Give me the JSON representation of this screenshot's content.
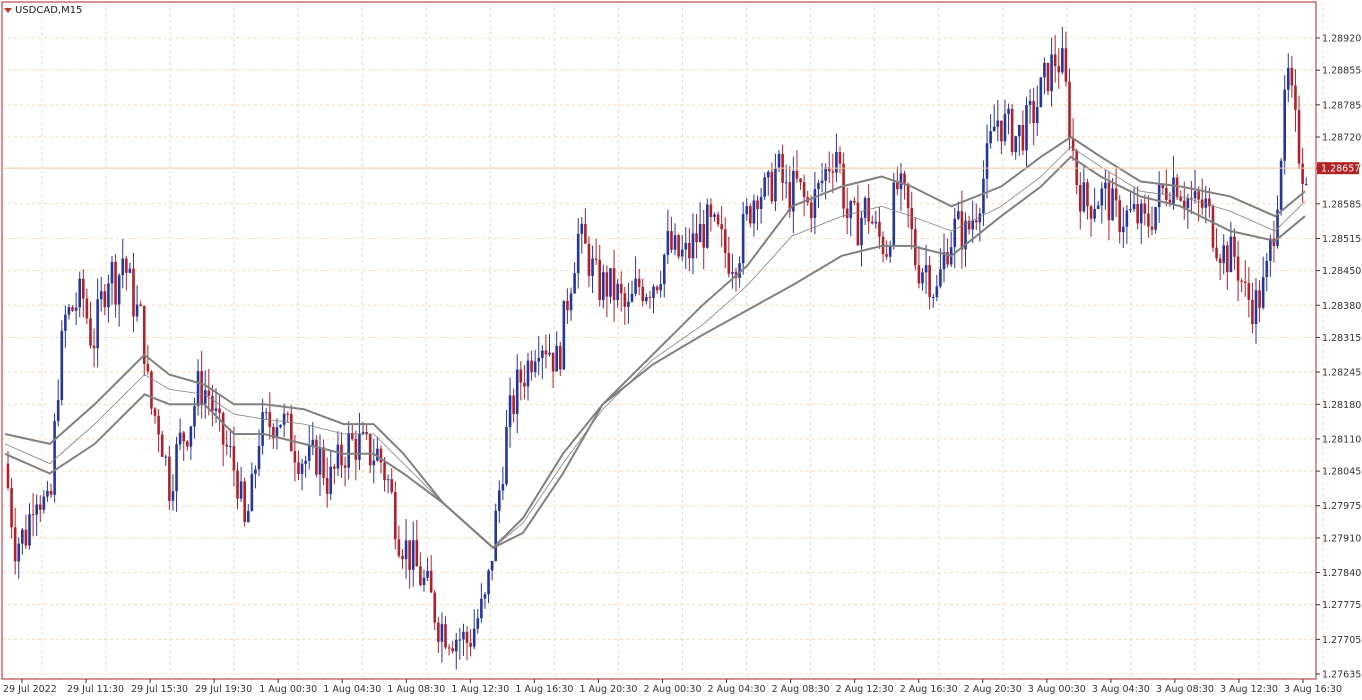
{
  "window": {
    "symbol_title": "USDCAD,M15"
  },
  "colors": {
    "background": "#ffffff",
    "frame": "#b22222",
    "grid": "#f3dcbf",
    "bull_candle": "#2336a0",
    "bear_candle": "#b0202a",
    "ma_line": "#808080",
    "current_price_bg": "#b22222",
    "current_price_text": "#ffffff",
    "axis_text": "#333333"
  },
  "chart_data": {
    "type": "candlestick",
    "symbol": "USDCAD",
    "timeframe": "M15",
    "price_axis_ticks": [
      "1.28920",
      "1.28855",
      "1.28785",
      "1.28720",
      "1.28657",
      "1.28585",
      "1.28515",
      "1.28450",
      "1.28380",
      "1.28315",
      "1.28245",
      "1.28180",
      "1.28110",
      "1.28045",
      "1.27975",
      "1.27910",
      "1.27840",
      "1.27775",
      "1.27705",
      "1.27635"
    ],
    "current_price": "1.28657",
    "ylim": [
      1.27635,
      1.28955
    ],
    "time_axis_labels": [
      "29 Jul 2022",
      "29 Jul 11:30",
      "29 Jul 15:30",
      "29 Jul 19:30",
      "1 Aug 00:30",
      "1 Aug 04:30",
      "1 Aug 08:30",
      "1 Aug 12:30",
      "1 Aug 16:30",
      "1 Aug 20:30",
      "2 Aug 00:30",
      "2 Aug 04:30",
      "2 Aug 08:30",
      "2 Aug 12:30",
      "2 Aug 16:30",
      "2 Aug 20:30",
      "3 Aug 00:30",
      "3 Aug 04:30",
      "3 Aug 08:30",
      "3 Aug 12:30",
      "3 Aug 16:30"
    ],
    "close_path": [
      [
        0,
        1.2806
      ],
      [
        10,
        1.279
      ],
      [
        22,
        1.2792
      ],
      [
        30,
        1.2802
      ],
      [
        45,
        1.2795
      ],
      [
        52,
        1.282
      ],
      [
        60,
        1.2835
      ],
      [
        70,
        1.2838
      ],
      [
        78,
        1.284
      ],
      [
        88,
        1.283
      ],
      [
        98,
        1.284
      ],
      [
        105,
        1.2846
      ],
      [
        112,
        1.2842
      ],
      [
        118,
        1.2848
      ],
      [
        130,
        1.2838
      ],
      [
        138,
        1.2834
      ],
      [
        145,
        1.2818
      ],
      [
        155,
        1.2814
      ],
      [
        165,
        1.2802
      ],
      [
        175,
        1.281
      ],
      [
        185,
        1.2814
      ],
      [
        195,
        1.2822
      ],
      [
        205,
        1.282
      ],
      [
        215,
        1.2812
      ],
      [
        225,
        1.2808
      ],
      [
        235,
        1.2802
      ],
      [
        240,
        1.2792
      ],
      [
        248,
        1.28
      ],
      [
        255,
        1.2812
      ],
      [
        265,
        1.2814
      ],
      [
        275,
        1.2816
      ],
      [
        285,
        1.2812
      ],
      [
        295,
        1.2808
      ],
      [
        305,
        1.2806
      ],
      [
        315,
        1.2808
      ],
      [
        325,
        1.2802
      ],
      [
        335,
        1.2806
      ],
      [
        345,
        1.281
      ],
      [
        355,
        1.281
      ],
      [
        365,
        1.2808
      ],
      [
        375,
        1.2808
      ],
      [
        385,
        1.2802
      ],
      [
        395,
        1.2792
      ],
      [
        405,
        1.2788
      ],
      [
        415,
        1.2784
      ],
      [
        425,
        1.278
      ],
      [
        435,
        1.2774
      ],
      [
        445,
        1.2772
      ],
      [
        455,
        1.2771
      ],
      [
        465,
        1.277
      ],
      [
        475,
        1.2775
      ],
      [
        483,
        1.2778
      ],
      [
        490,
        1.279
      ],
      [
        497,
        1.2802
      ],
      [
        505,
        1.2814
      ],
      [
        515,
        1.2822
      ],
      [
        525,
        1.2826
      ],
      [
        535,
        1.2832
      ],
      [
        545,
        1.283
      ],
      [
        555,
        1.2826
      ],
      [
        565,
        1.284
      ],
      [
        575,
        1.2852
      ],
      [
        585,
        1.2848
      ],
      [
        595,
        1.2842
      ],
      [
        605,
        1.2842
      ],
      [
        615,
        1.284
      ],
      [
        625,
        1.2836
      ],
      [
        635,
        1.2842
      ],
      [
        645,
        1.2842
      ],
      [
        655,
        1.2844
      ],
      [
        665,
        1.285
      ],
      [
        675,
        1.2848
      ],
      [
        685,
        1.2848
      ],
      [
        695,
        1.2852
      ],
      [
        705,
        1.2854
      ],
      [
        715,
        1.2852
      ],
      [
        725,
        1.2848
      ],
      [
        735,
        1.2848
      ],
      [
        745,
        1.2856
      ],
      [
        755,
        1.2862
      ],
      [
        765,
        1.286
      ],
      [
        775,
        1.2866
      ],
      [
        785,
        1.286
      ],
      [
        795,
        1.2862
      ],
      [
        805,
        1.2858
      ],
      [
        815,
        1.286
      ],
      [
        825,
        1.2866
      ],
      [
        835,
        1.287
      ],
      [
        845,
        1.2856
      ],
      [
        855,
        1.2854
      ],
      [
        865,
        1.2858
      ],
      [
        875,
        1.2852
      ],
      [
        885,
        1.285
      ],
      [
        895,
        1.2862
      ],
      [
        905,
        1.2858
      ],
      [
        915,
        1.2846
      ],
      [
        925,
        1.2846
      ],
      [
        935,
        1.284
      ],
      [
        945,
        1.285
      ],
      [
        955,
        1.2854
      ],
      [
        965,
        1.2852
      ],
      [
        975,
        1.2858
      ],
      [
        985,
        1.2866
      ],
      [
        995,
        1.2876
      ],
      [
        1005,
        1.2874
      ],
      [
        1015,
        1.2872
      ],
      [
        1025,
        1.2874
      ],
      [
        1035,
        1.2878
      ],
      [
        1045,
        1.2884
      ],
      [
        1055,
        1.2888
      ],
      [
        1062,
        1.2886
      ],
      [
        1068,
        1.2876
      ],
      [
        1075,
        1.2864
      ],
      [
        1085,
        1.2858
      ],
      [
        1095,
        1.286
      ],
      [
        1105,
        1.286
      ],
      [
        1115,
        1.2856
      ],
      [
        1125,
        1.2856
      ],
      [
        1135,
        1.2856
      ],
      [
        1145,
        1.2854
      ],
      [
        1155,
        1.2858
      ],
      [
        1165,
        1.2862
      ],
      [
        1175,
        1.2864
      ],
      [
        1185,
        1.286
      ],
      [
        1195,
        1.2858
      ],
      [
        1205,
        1.2858
      ],
      [
        1215,
        1.2852
      ],
      [
        1225,
        1.2848
      ],
      [
        1235,
        1.2848
      ],
      [
        1245,
        1.284
      ],
      [
        1255,
        1.2838
      ],
      [
        1265,
        1.2842
      ],
      [
        1275,
        1.2856
      ],
      [
        1282,
        1.2872
      ],
      [
        1288,
        1.2884
      ],
      [
        1295,
        1.2874
      ],
      [
        1302,
        1.2866
      ],
      [
        1308,
        1.2866
      ]
    ],
    "ma_lines": [
      {
        "role": "upper_band",
        "weight": "thick",
        "points": [
          [
            0,
            1.2812
          ],
          [
            45,
            1.281
          ],
          [
            90,
            1.2818
          ],
          [
            140,
            1.2828
          ],
          [
            165,
            1.2824
          ],
          [
            200,
            1.2822
          ],
          [
            230,
            1.2818
          ],
          [
            260,
            1.2818
          ],
          [
            300,
            1.2817
          ],
          [
            340,
            1.2814
          ],
          [
            370,
            1.2814
          ],
          [
            400,
            1.2808
          ],
          [
            440,
            1.2798
          ],
          [
            490,
            1.2789
          ],
          [
            520,
            1.2795
          ],
          [
            560,
            1.2808
          ],
          [
            600,
            1.2818
          ],
          [
            650,
            1.2828
          ],
          [
            700,
            1.2838
          ],
          [
            745,
            1.2846
          ],
          [
            790,
            1.2858
          ],
          [
            840,
            1.2862
          ],
          [
            880,
            1.2864
          ],
          [
            910,
            1.2862
          ],
          [
            950,
            1.2858
          ],
          [
            1000,
            1.2862
          ],
          [
            1040,
            1.2868
          ],
          [
            1070,
            1.2872
          ],
          [
            1100,
            1.2868
          ],
          [
            1140,
            1.2863
          ],
          [
            1180,
            1.2862
          ],
          [
            1230,
            1.286
          ],
          [
            1275,
            1.2856
          ],
          [
            1305,
            1.2861
          ]
        ]
      },
      {
        "role": "middle",
        "weight": "thin",
        "points": [
          [
            0,
            1.281
          ],
          [
            45,
            1.2806
          ],
          [
            90,
            1.2814
          ],
          [
            140,
            1.2824
          ],
          [
            165,
            1.2821
          ],
          [
            200,
            1.282
          ],
          [
            230,
            1.2816
          ],
          [
            260,
            1.2815
          ],
          [
            300,
            1.2814
          ],
          [
            340,
            1.2812
          ],
          [
            370,
            1.2812
          ],
          [
            400,
            1.2806
          ],
          [
            440,
            1.2798
          ],
          [
            490,
            1.2789
          ],
          [
            520,
            1.2794
          ],
          [
            560,
            1.2806
          ],
          [
            600,
            1.2817
          ],
          [
            650,
            1.2827
          ],
          [
            700,
            1.2834
          ],
          [
            745,
            1.2842
          ],
          [
            790,
            1.2852
          ],
          [
            840,
            1.2856
          ],
          [
            880,
            1.2858
          ],
          [
            910,
            1.2856
          ],
          [
            950,
            1.2853
          ],
          [
            1000,
            1.2858
          ],
          [
            1040,
            1.2864
          ],
          [
            1070,
            1.287
          ],
          [
            1100,
            1.2866
          ],
          [
            1140,
            1.2861
          ],
          [
            1180,
            1.286
          ],
          [
            1230,
            1.2857
          ],
          [
            1275,
            1.2853
          ],
          [
            1305,
            1.2859
          ]
        ]
      },
      {
        "role": "lower_band",
        "weight": "thick",
        "points": [
          [
            0,
            1.2808
          ],
          [
            45,
            1.2804
          ],
          [
            90,
            1.281
          ],
          [
            140,
            1.282
          ],
          [
            165,
            1.2818
          ],
          [
            200,
            1.2818
          ],
          [
            230,
            1.2812
          ],
          [
            260,
            1.2812
          ],
          [
            300,
            1.281
          ],
          [
            340,
            1.2808
          ],
          [
            370,
            1.2808
          ],
          [
            400,
            1.2804
          ],
          [
            440,
            1.2798
          ],
          [
            490,
            1.2789
          ],
          [
            520,
            1.2792
          ],
          [
            560,
            1.2804
          ],
          [
            600,
            1.2818
          ],
          [
            650,
            1.2826
          ],
          [
            700,
            1.2832
          ],
          [
            745,
            1.2837
          ],
          [
            790,
            1.2842
          ],
          [
            840,
            1.2848
          ],
          [
            880,
            1.285
          ],
          [
            910,
            1.285
          ],
          [
            950,
            1.2848
          ],
          [
            1000,
            1.2856
          ],
          [
            1040,
            1.2862
          ],
          [
            1070,
            1.2868
          ],
          [
            1100,
            1.2864
          ],
          [
            1140,
            1.286
          ],
          [
            1180,
            1.2858
          ],
          [
            1230,
            1.2853
          ],
          [
            1275,
            1.2851
          ],
          [
            1305,
            1.2856
          ]
        ]
      }
    ]
  }
}
